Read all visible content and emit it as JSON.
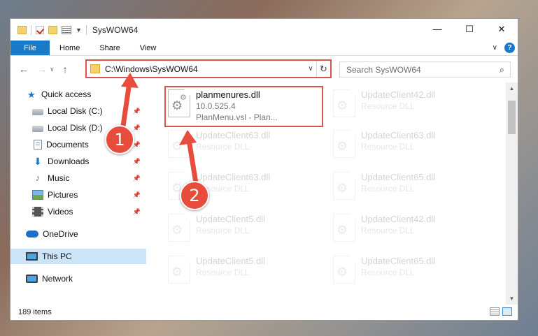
{
  "window": {
    "title": "SysWOW64",
    "min_icon": "minimize-icon",
    "max_icon": "maximize-icon",
    "close_icon": "close-icon"
  },
  "ribbon": {
    "tabs": [
      "File",
      "Home",
      "Share",
      "View"
    ],
    "help": "?"
  },
  "nav": {
    "back": "←",
    "forward": "→",
    "recent": "∨",
    "up": "↑"
  },
  "address": {
    "path": "C:\\Windows\\SysWOW64",
    "dropdown": "∨",
    "refresh": "↻"
  },
  "search": {
    "placeholder": "Search SysWOW64",
    "icon": "⌕"
  },
  "sidebar": {
    "items": [
      {
        "label": "Quick access",
        "icon": "star-icon"
      },
      {
        "label": "Local Disk (C:)",
        "icon": "drive-icon",
        "pinned": true
      },
      {
        "label": "Local Disk (D:)",
        "icon": "drive-icon",
        "pinned": true
      },
      {
        "label": "Documents",
        "icon": "documents-icon",
        "pinned": true
      },
      {
        "label": "Downloads",
        "icon": "downloads-icon",
        "pinned": true
      },
      {
        "label": "Music",
        "icon": "music-icon",
        "pinned": true
      },
      {
        "label": "Pictures",
        "icon": "pictures-icon",
        "pinned": true
      },
      {
        "label": "Videos",
        "icon": "videos-icon",
        "pinned": true
      },
      {
        "label": "OneDrive",
        "icon": "cloud-icon"
      },
      {
        "label": "This PC",
        "icon": "computer-icon",
        "selected": true
      },
      {
        "label": "Network",
        "icon": "network-icon"
      }
    ]
  },
  "files": {
    "highlighted": {
      "name": "planmenures.dll",
      "version": "10.0.525.4",
      "description": "PlanMenu.vsl - Plan..."
    },
    "faded": [
      {
        "name": "UpdateClient42.dll",
        "type": "Resource DLL"
      },
      {
        "name": "UpdateClient63.dll",
        "type": "Resource DLL"
      },
      {
        "name": "UpdateClient63.dll",
        "type": "Resource DLL"
      },
      {
        "name": "UpdateClient63.dll",
        "type": "Resource DLL"
      },
      {
        "name": "UpdateClient65.dll",
        "type": "Resource DLL"
      },
      {
        "name": "UpdateClient5.dll",
        "type": "Resource DLL"
      },
      {
        "name": "UpdateClient42.dll",
        "type": "Resource DLL"
      },
      {
        "name": "UpdateClient5.dll",
        "type": "Resource DLL"
      },
      {
        "name": "UpdateClient65.dll",
        "type": "Resource DLL"
      }
    ]
  },
  "status": {
    "count": "189 items"
  },
  "annotations": {
    "step1": "1",
    "step2": "2",
    "color": "#e74c3c"
  }
}
